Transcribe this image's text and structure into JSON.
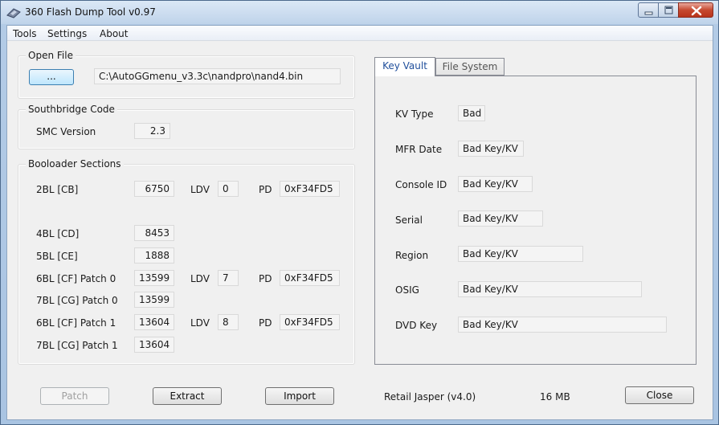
{
  "window": {
    "title": "360 Flash Dump Tool  v0.97"
  },
  "menu": {
    "items": [
      "Tools",
      "Settings",
      "About"
    ]
  },
  "open_file": {
    "group_title": "Open File",
    "browse_label": "...",
    "path": "C:\\AutoGGmenu_v3.3c\\nandpro\\nand4.bin"
  },
  "southbridge": {
    "group_title": "Southbridge Code",
    "smc_label": "SMC Version",
    "smc_value": "2.3"
  },
  "bootloader": {
    "group_title": "Booloader Sections",
    "ldv_label": "LDV",
    "pd_label": "PD",
    "cb": {
      "label": "2BL [CB]",
      "value": "6750",
      "ldv": "0",
      "pd": "0xF34FD5"
    },
    "cd": {
      "label": "4BL [CD]",
      "value": "8453"
    },
    "ce": {
      "label": "5BL [CE]",
      "value": "1888"
    },
    "cf0": {
      "label": "6BL [CF] Patch 0",
      "value": "13599",
      "ldv": "7",
      "pd": "0xF34FD5"
    },
    "cg0": {
      "label": "7BL [CG] Patch 0",
      "value": "13599"
    },
    "cf1": {
      "label": "6BL [CF] Patch 1",
      "value": "13604",
      "ldv": "8",
      "pd": "0xF34FD5"
    },
    "cg1": {
      "label": "7BL [CG] Patch 1",
      "value": "13604"
    }
  },
  "tabs": {
    "key_vault": "Key Vault",
    "file_system": "File System",
    "active": "Key Vault"
  },
  "key_vault": {
    "kv_type": {
      "label": "KV Type",
      "value": "Bad"
    },
    "mfr_date": {
      "label": "MFR Date",
      "value": "Bad Key/KV"
    },
    "console_id": {
      "label": "Console ID",
      "value": "Bad Key/KV"
    },
    "serial": {
      "label": "Serial",
      "value": "Bad Key/KV"
    },
    "region": {
      "label": "Region",
      "value": "Bad Key/KV"
    },
    "osig": {
      "label": "OSIG",
      "value": "Bad Key/KV"
    },
    "dvd_key": {
      "label": "DVD Key",
      "value": "Bad Key/KV"
    }
  },
  "buttons": {
    "patch": "Patch",
    "extract": "Extract",
    "import": "Import",
    "close": "Close"
  },
  "status": {
    "console_type": "Retail Jasper (v4.0)",
    "size": "16 MB"
  },
  "colors": {
    "frame": "#a9c4e2",
    "client": "#f0f0f0",
    "close_button": "#c6492f",
    "active_tab_text": "#1f4e9b"
  },
  "icons": [
    "flash-app-icon",
    "minimize-icon",
    "maximize-icon",
    "close-icon"
  ]
}
